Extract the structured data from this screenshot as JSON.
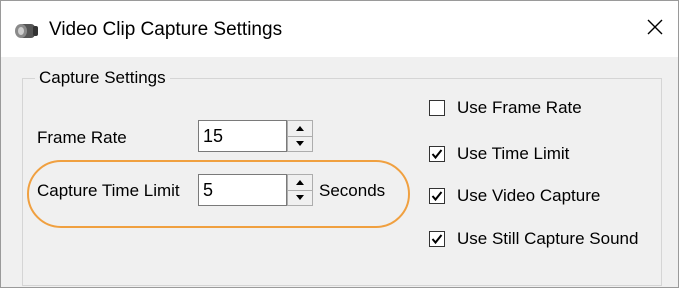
{
  "window": {
    "title": "Video Clip Capture Settings",
    "app_icon": "camera-icon",
    "close_icon": "close-icon"
  },
  "group": {
    "legend": "Capture Settings"
  },
  "fields": {
    "frame_rate": {
      "label": "Frame Rate",
      "value": "15"
    },
    "time_limit": {
      "label": "Capture Time Limit",
      "value": "5",
      "unit": "Seconds"
    }
  },
  "checkboxes": [
    {
      "label": "Use Frame Rate",
      "checked": false
    },
    {
      "label": "Use Time Limit",
      "checked": true
    },
    {
      "label": "Use Video Capture",
      "checked": true
    },
    {
      "label": "Use Still Capture Sound",
      "checked": true
    }
  ],
  "colors": {
    "highlight": "#f0a040",
    "window_bg": "#f0f0f0"
  }
}
